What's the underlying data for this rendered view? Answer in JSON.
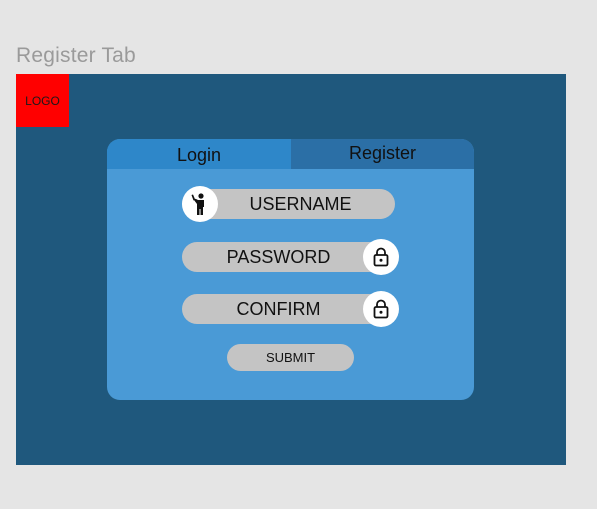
{
  "frame": {
    "title": "Register Tab"
  },
  "logo": {
    "label": "LOGO",
    "color": "#ff0000"
  },
  "tabs": [
    {
      "label": "Login",
      "active": true
    },
    {
      "label": "Register",
      "active": false
    }
  ],
  "fields": {
    "username": {
      "placeholder": "USERNAME",
      "icon": "person-waving-icon"
    },
    "password": {
      "placeholder": "PASSWORD",
      "icon": "lock-icon"
    },
    "confirm": {
      "placeholder": "CONFIRM",
      "icon": "lock-icon"
    }
  },
  "submit": {
    "label": "SUBMIT"
  },
  "colors": {
    "background": "#e5e5e5",
    "frame": "#1f587d",
    "card": "#4a9ad6",
    "tab_active": "#2e87c9",
    "tab_inactive": "#2b6fa6",
    "field": "#c4c4c4"
  }
}
